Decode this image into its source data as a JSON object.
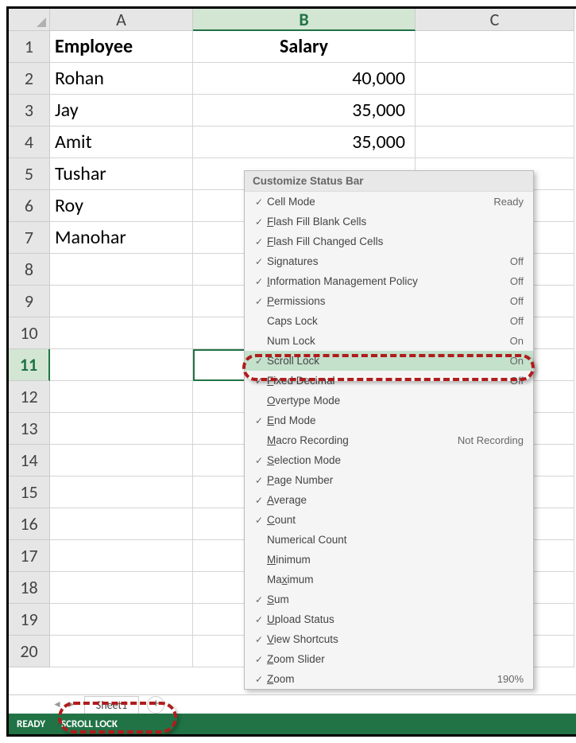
{
  "columns": {
    "A": "A",
    "B": "B",
    "C": "C"
  },
  "rows": [
    "1",
    "2",
    "3",
    "4",
    "5",
    "6",
    "7",
    "8",
    "9",
    "10",
    "11",
    "12",
    "13",
    "14",
    "15",
    "16",
    "17",
    "18",
    "19",
    "20"
  ],
  "headers": {
    "A1": "Employee",
    "B1": "Salary"
  },
  "data": {
    "A2": "Rohan",
    "B2": "40,000",
    "A3": "Jay",
    "B3": "35,000",
    "A4": "Amit",
    "B4": "35,000",
    "A5": "Tushar",
    "A6": "Roy",
    "A7": "Manohar"
  },
  "tab": "Sheet1",
  "status": {
    "ready": "READY",
    "scrolllock": "SCROLL LOCK"
  },
  "menu": {
    "title": "Customize Status Bar",
    "items": [
      {
        "chk": true,
        "label": "Cell Mode",
        "value": "Ready"
      },
      {
        "chk": true,
        "label": "Flash Fill Blank Cells",
        "u": "F"
      },
      {
        "chk": true,
        "label": "Flash Fill Changed Cells",
        "u": "F"
      },
      {
        "chk": true,
        "label": "Signatures",
        "value": "Off"
      },
      {
        "chk": true,
        "label": "Information Management Policy",
        "u": "I",
        "value": "Off"
      },
      {
        "chk": true,
        "label": "Permissions",
        "u": "P",
        "value": "Off"
      },
      {
        "chk": false,
        "label": "Caps Lock",
        "value": "Off"
      },
      {
        "chk": false,
        "label": "Num Lock",
        "value": "On"
      },
      {
        "chk": true,
        "label": "Scroll Lock",
        "value": "On",
        "highlight": true
      },
      {
        "chk": true,
        "label": "Fixed Decimal",
        "u": "F",
        "value": "Off"
      },
      {
        "chk": false,
        "label": "Overtype Mode",
        "u": "O"
      },
      {
        "chk": true,
        "label": "End Mode",
        "u": "E"
      },
      {
        "chk": false,
        "label": "Macro Recording",
        "u": "M",
        "value": "Not Recording"
      },
      {
        "chk": true,
        "label": "Selection Mode",
        "u": "S"
      },
      {
        "chk": true,
        "label": "Page Number",
        "u": "P"
      },
      {
        "chk": true,
        "label": "Average",
        "u": "A"
      },
      {
        "chk": true,
        "label": "Count",
        "u": "C"
      },
      {
        "chk": false,
        "label": "Numerical Count"
      },
      {
        "chk": false,
        "label": "Minimum",
        "u": "M"
      },
      {
        "chk": false,
        "label": "Maximum",
        "u": "x"
      },
      {
        "chk": true,
        "label": "Sum",
        "u": "S"
      },
      {
        "chk": true,
        "label": "Upload Status",
        "u": "U"
      },
      {
        "chk": true,
        "label": "View Shortcuts",
        "u": "V"
      },
      {
        "chk": true,
        "label": "Zoom Slider",
        "u": "Z"
      },
      {
        "chk": true,
        "label": "Zoom",
        "u": "Z",
        "value": "190%"
      }
    ]
  }
}
